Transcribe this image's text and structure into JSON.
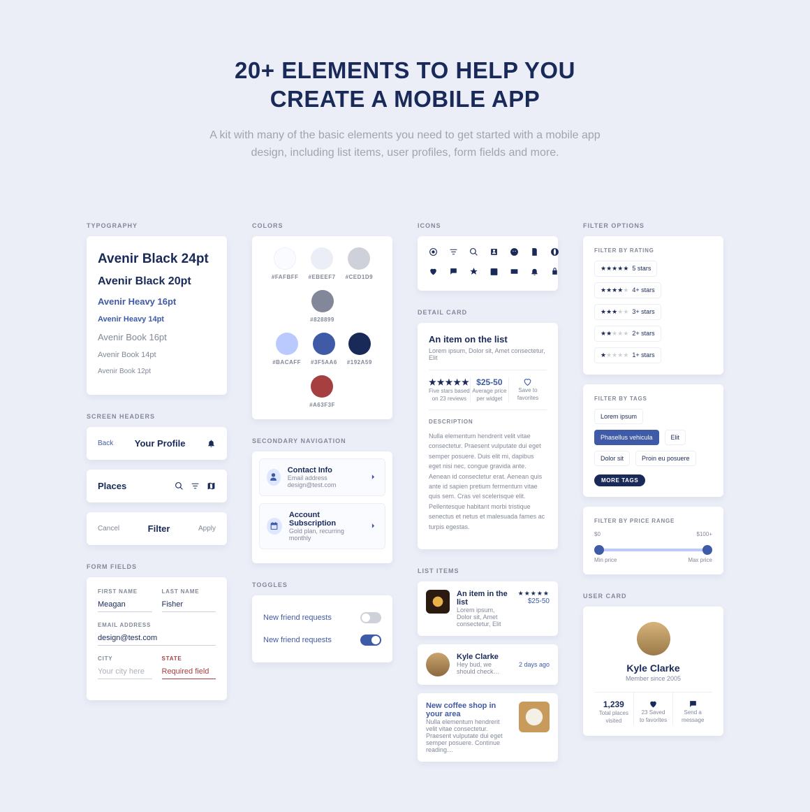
{
  "hero": {
    "title_line1": "20+ ELEMENTS TO HELP YOU",
    "title_line2": "CREATE A MOBILE APP",
    "subtitle": "A kit with many of the basic elements you need to get started with a mobile app design, including list items, user profiles, form fields and more."
  },
  "labels": {
    "typography": "TYPOGRAPHY",
    "screen_headers": "SCREEN HEADERS",
    "form_fields": "FORM FIELDS",
    "colors": "COLORS",
    "secondary_nav": "SECONDARY NAVIGATION",
    "toggles": "TOGGLES",
    "icons": "ICONS",
    "detail_card": "DETAIL CARD",
    "list_items": "LIST ITEMS",
    "filter_options": "FILTER OPTIONS",
    "user_card": "USER CARD"
  },
  "typography": {
    "items": [
      "Avenir Black 24pt",
      "Avenir Black 20pt",
      "Avenir Heavy 16pt",
      "Avenir Heavy 14pt",
      "Avenir Book 16pt",
      "Avenir Book 14pt",
      "Avenir Book 12pt"
    ]
  },
  "headers": {
    "h1": {
      "left": "Back",
      "title": "Your Profile"
    },
    "h2": {
      "title": "Places"
    },
    "h3": {
      "left": "Cancel",
      "title": "Filter",
      "right": "Apply"
    }
  },
  "form": {
    "first_name": {
      "label": "FIRST NAME",
      "value": "Meagan"
    },
    "last_name": {
      "label": "LAST NAME",
      "value": "Fisher"
    },
    "email": {
      "label": "EMAIL ADDRESS",
      "value": "design@test.com"
    },
    "city": {
      "label": "CITY",
      "placeholder": "Your city here"
    },
    "state": {
      "label": "STATE",
      "value": "Required field"
    }
  },
  "colors": {
    "swatches": [
      {
        "hex": "#FAFBFF"
      },
      {
        "hex": "#EBEEF7"
      },
      {
        "hex": "#CED1D9"
      },
      {
        "hex": "#828899"
      },
      {
        "hex": "#BACAFF"
      },
      {
        "hex": "#3F5AA6"
      },
      {
        "hex": "#192A59"
      },
      {
        "hex": "#A63F3F"
      }
    ]
  },
  "secondary_nav": {
    "items": [
      {
        "title": "Contact Info",
        "sub": "Email address design@test.com"
      },
      {
        "title": "Account Subscription",
        "sub": "Gold plan, recurring monthly"
      }
    ]
  },
  "toggles": {
    "items": [
      {
        "label": "New friend requests",
        "on": false
      },
      {
        "label": "New friend requests",
        "on": true
      }
    ]
  },
  "detail": {
    "title": "An item on the list",
    "sub": "Lorem ipsum, Dolor sit, Amet consectetur, Elit",
    "stars_label1": "Five stars based",
    "stars_label2": "on 23 reviews",
    "price": "$25-50",
    "price_label1": "Average price",
    "price_label2": "per widget",
    "fav_label1": "Save to",
    "fav_label2": "favorites",
    "desc_heading": "DESCRIPTION",
    "desc": "Nulla elementum hendrerit velit vitae consectetur. Praesent vulputate dui eget semper posuere. Duis elit mi, dapibus eget nisi nec, congue gravida ante. Aenean id consectetur erat. Aenean quis ante id sapien pretium fermentum vitae quis sem. Cras vel scelerisque elit. Pellentesque habitant morbi tristique senectus et netus et malesuada fames ac turpis egestas."
  },
  "list_items": {
    "item1": {
      "title": "An item in the list",
      "sub": "Lorem ipsum, Dolor sit, Amet consectetur, Elit",
      "price": "$25-50"
    },
    "item2": {
      "title": "Kyle Clarke",
      "sub": "Hey bud, we should check…",
      "time": "2 days ago"
    },
    "item3": {
      "title": "New coffee shop in your area",
      "sub": "Nulla elementum hendrerit velit vitae consectetur. Praesent vulputate dui eget semper posuere. Continue reading…"
    }
  },
  "filters": {
    "by_rating_label": "FILTER BY RATING",
    "ratings": [
      {
        "filled": 5,
        "txt": "5 stars"
      },
      {
        "filled": 4,
        "txt": "4+ stars"
      },
      {
        "filled": 3,
        "txt": "3+ stars"
      },
      {
        "filled": 2,
        "txt": "2+ stars"
      },
      {
        "filled": 1,
        "txt": "1+ stars"
      }
    ],
    "by_tags_label": "FILTER BY TAGS",
    "tags": [
      {
        "txt": "Lorem ipsum",
        "active": false
      },
      {
        "txt": "Phasellus vehicula",
        "active": true
      },
      {
        "txt": "Elit",
        "active": false
      },
      {
        "txt": "Dolor sit",
        "active": false
      },
      {
        "txt": "Proin eu posuere",
        "active": false
      }
    ],
    "more_tags": "MORE TAGS",
    "by_price_label": "FILTER BY PRICE RANGE",
    "price_min": "$0",
    "price_max": "$100+",
    "min_label": "Min price",
    "max_label": "Max price"
  },
  "user": {
    "name": "Kyle Clarke",
    "since": "Member since 2005",
    "stat1_num": "1,239",
    "stat1_txt1": "Total places",
    "stat1_txt2": "visited",
    "stat2_txt1": "23 Saved",
    "stat2_txt2": "to favorites",
    "stat3_txt1": "Send a",
    "stat3_txt2": "message"
  }
}
